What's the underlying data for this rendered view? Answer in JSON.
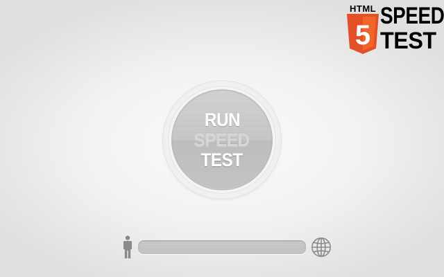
{
  "logo": {
    "html_label": "HTML",
    "shield_number": "5",
    "word_1": "SPEED",
    "word_2": "TEST",
    "shield_color": "#e34f26",
    "shield_highlight": "#f06529"
  },
  "run_button": {
    "line_1": "RUN",
    "line_2": "SPEED",
    "line_3": "TEST"
  },
  "progress": {
    "left_icon": "person-icon",
    "right_icon": "globe-icon",
    "value": 0
  },
  "colors": {
    "background": "#f1f1f1",
    "button_face": "#c6c6c6",
    "icon_gray": "#8a8a8a"
  }
}
